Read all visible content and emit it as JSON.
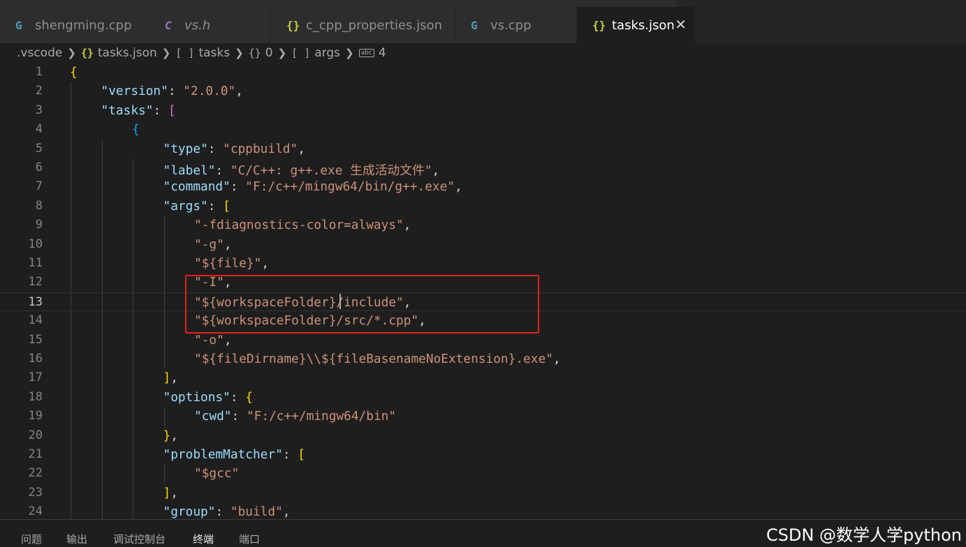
{
  "tabs": [
    {
      "label": "shengming.cpp",
      "icon": "cpp-file-icon",
      "glyph": "G"
    },
    {
      "label": "vs.h",
      "icon": "c-header-file-icon",
      "glyph": "C"
    },
    {
      "label": "c_cpp_properties.json",
      "icon": "json-file-icon",
      "glyph": "{}"
    },
    {
      "label": "vs.cpp",
      "icon": "cpp-file-icon",
      "glyph": "G"
    },
    {
      "label": "tasks.json",
      "icon": "json-file-icon",
      "glyph": "{}",
      "active": true
    }
  ],
  "breadcrumb": [
    {
      "label": ".vscode",
      "icon": ""
    },
    {
      "label": "tasks.json",
      "icon": "{}"
    },
    {
      "label": "tasks",
      "icon": "[ ]"
    },
    {
      "label": "0",
      "icon": "{}"
    },
    {
      "label": "args",
      "icon": "[ ]"
    },
    {
      "label": "4",
      "icon": "abc"
    }
  ],
  "editor": {
    "current_line": 13,
    "lines": [
      {
        "n": "1",
        "indent": 0,
        "tokens": [
          [
            "b1",
            "{"
          ]
        ]
      },
      {
        "n": "2",
        "indent": 1,
        "tokens": [
          [
            "k",
            "\"version\""
          ],
          [
            "p",
            ": "
          ],
          [
            "s",
            "\"2.0.0\""
          ],
          [
            "p",
            ","
          ]
        ]
      },
      {
        "n": "3",
        "indent": 1,
        "tokens": [
          [
            "k",
            "\"tasks\""
          ],
          [
            "p",
            ": "
          ],
          [
            "b2",
            "["
          ]
        ]
      },
      {
        "n": "4",
        "indent": 2,
        "tokens": [
          [
            "b3",
            "{"
          ]
        ]
      },
      {
        "n": "5",
        "indent": 3,
        "tokens": [
          [
            "k",
            "\"type\""
          ],
          [
            "p",
            ": "
          ],
          [
            "s",
            "\"cppbuild\""
          ],
          [
            "p",
            ","
          ]
        ]
      },
      {
        "n": "6",
        "indent": 3,
        "tokens": [
          [
            "k",
            "\"label\""
          ],
          [
            "p",
            ": "
          ],
          [
            "s",
            "\"C/C++: g++.exe 生成活动文件\""
          ],
          [
            "p",
            ","
          ]
        ]
      },
      {
        "n": "7",
        "indent": 3,
        "tokens": [
          [
            "k",
            "\"command\""
          ],
          [
            "p",
            ": "
          ],
          [
            "s",
            "\"F:/c++/mingw64/bin/g++.exe\""
          ],
          [
            "p",
            ","
          ]
        ]
      },
      {
        "n": "8",
        "indent": 3,
        "tokens": [
          [
            "k",
            "\"args\""
          ],
          [
            "p",
            ": "
          ],
          [
            "b1",
            "["
          ]
        ]
      },
      {
        "n": "9",
        "indent": 4,
        "tokens": [
          [
            "s",
            "\"-fdiagnostics-color=always\""
          ],
          [
            "p",
            ","
          ]
        ]
      },
      {
        "n": "10",
        "indent": 4,
        "tokens": [
          [
            "s",
            "\"-g\""
          ],
          [
            "p",
            ","
          ]
        ]
      },
      {
        "n": "11",
        "indent": 4,
        "tokens": [
          [
            "s",
            "\"${file}\""
          ],
          [
            "p",
            ","
          ]
        ]
      },
      {
        "n": "12",
        "indent": 4,
        "tokens": [
          [
            "s",
            "\"-I\""
          ],
          [
            "p",
            ","
          ]
        ]
      },
      {
        "n": "13",
        "indent": 4,
        "tokens": [
          [
            "s",
            "\"${workspaceFolder}/include\""
          ],
          [
            "p",
            ","
          ]
        ]
      },
      {
        "n": "14",
        "indent": 4,
        "tokens": [
          [
            "s",
            "\"${workspaceFolder}/src/*.cpp\""
          ],
          [
            "p",
            ","
          ]
        ]
      },
      {
        "n": "15",
        "indent": 4,
        "tokens": [
          [
            "s",
            "\"-o\""
          ],
          [
            "p",
            ","
          ]
        ]
      },
      {
        "n": "16",
        "indent": 4,
        "tokens": [
          [
            "s",
            "\"${fileDirname}\\\\${fileBasenameNoExtension}.exe\""
          ],
          [
            "p",
            ","
          ]
        ]
      },
      {
        "n": "17",
        "indent": 3,
        "tokens": [
          [
            "b1",
            "]"
          ],
          [
            "p",
            ","
          ]
        ]
      },
      {
        "n": "18",
        "indent": 3,
        "tokens": [
          [
            "k",
            "\"options\""
          ],
          [
            "p",
            ": "
          ],
          [
            "b1",
            "{"
          ]
        ]
      },
      {
        "n": "19",
        "indent": 4,
        "tokens": [
          [
            "k",
            "\"cwd\""
          ],
          [
            "p",
            ": "
          ],
          [
            "s",
            "\"F:/c++/mingw64/bin\""
          ]
        ]
      },
      {
        "n": "20",
        "indent": 3,
        "tokens": [
          [
            "b1",
            "}"
          ],
          [
            "p",
            ","
          ]
        ]
      },
      {
        "n": "21",
        "indent": 3,
        "tokens": [
          [
            "k",
            "\"problemMatcher\""
          ],
          [
            "p",
            ": "
          ],
          [
            "b1",
            "["
          ]
        ]
      },
      {
        "n": "22",
        "indent": 4,
        "tokens": [
          [
            "s",
            "\"$gcc\""
          ]
        ]
      },
      {
        "n": "23",
        "indent": 3,
        "tokens": [
          [
            "b1",
            "]"
          ],
          [
            "p",
            ","
          ]
        ]
      },
      {
        "n": "24",
        "indent": 3,
        "tokens": [
          [
            "k",
            "\"group\""
          ],
          [
            "p",
            ": "
          ],
          [
            "s",
            "\"build\""
          ],
          [
            "p",
            ","
          ]
        ]
      }
    ]
  },
  "panel": {
    "tabs": [
      "问题",
      "输出",
      "调试控制台",
      "终端",
      "端口"
    ],
    "active": "终端"
  },
  "watermark": "CSDN @数学人学python",
  "colors": {
    "highlight_box": "#e3211e",
    "key": "#9cdcfe",
    "string": "#ce9178",
    "bracket_gold": "#ffd700",
    "bracket_pink": "#da70d6",
    "bracket_blue": "#179fff"
  }
}
